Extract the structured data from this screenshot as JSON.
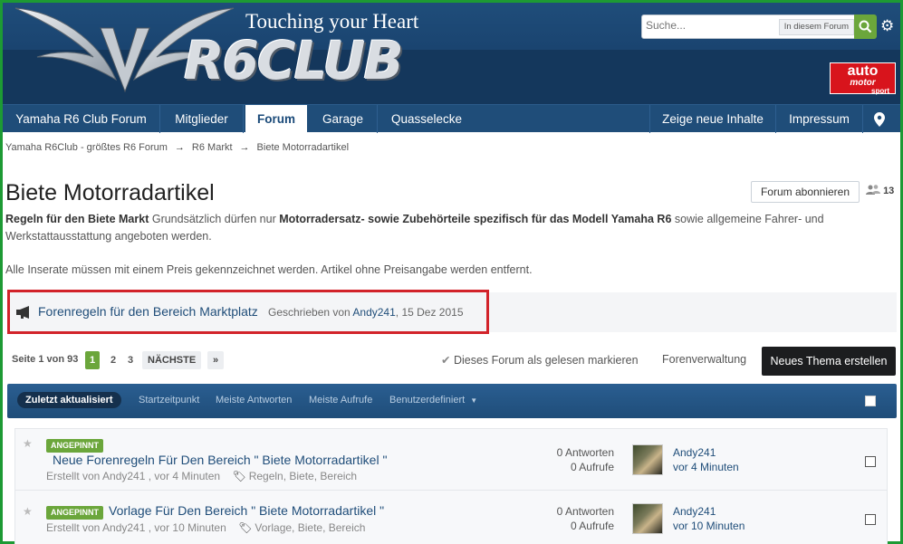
{
  "header": {
    "tagline": "Touching your Heart",
    "logo_text": "R6CLUB",
    "search": {
      "placeholder": "Suche...",
      "scope": "In diesem Forum"
    },
    "ad": {
      "line1": "auto",
      "line2": "motor",
      "line3": "sport"
    }
  },
  "nav": {
    "items": [
      {
        "label": "Yamaha R6 Club Forum"
      },
      {
        "label": "Mitglieder"
      },
      {
        "label": "Forum"
      },
      {
        "label": "Garage"
      },
      {
        "label": "Quasselecke"
      }
    ],
    "right_items": [
      {
        "label": "Zeige neue Inhalte"
      },
      {
        "label": "Impressum"
      }
    ],
    "active_index": 2
  },
  "breadcrumb": {
    "items": [
      "Yamaha R6Club - größtes R6 Forum",
      "R6 Markt",
      "Biete Motorradartikel"
    ],
    "separator": "→"
  },
  "page": {
    "title": "Biete Motorradartikel",
    "subscribe_label": "Forum abonnieren",
    "watchers": "13",
    "desc_bold1": "Regeln für den Biete Markt",
    "desc_text1": " Grundsätzlich dürfen nur ",
    "desc_bold2": "Motorradersatz- sowie Zubehörteile spezifisch für das Modell Yamaha R6",
    "desc_text2": " sowie allgemeine Fahrer- und Werkstattausstattung angeboten werden.",
    "desc_line2": "Alle Inserate müssen mit einem Preis gekennzeichnet werden. Artikel ohne Preisangabe werden entfernt."
  },
  "announcement": {
    "title": "Forenregeln für den Bereich Marktplatz",
    "meta_prefix": "Geschrieben von",
    "author": "Andy241",
    "date": ", 15 Dez 2015"
  },
  "pagination": {
    "label": "Seite 1 von 93",
    "pages": [
      "1",
      "2",
      "3"
    ],
    "next": "NÄCHSTE",
    "last": "»"
  },
  "actions": {
    "mark_read": "Dieses Forum als gelesen markieren",
    "forum_admin": "Forenverwaltung",
    "new_thread": "Neues Thema erstellen"
  },
  "filters": {
    "tabs": [
      "Zuletzt aktualisiert",
      "Startzeitpunkt",
      "Meiste Antworten",
      "Meiste Aufrufe",
      "Benutzerdefiniert"
    ]
  },
  "threads": [
    {
      "badge": "ANGEPINNT",
      "title": "Neue Forenregeln Für Den Bereich \" Biete Motorradartikel \"",
      "meta": "Erstellt von Andy241 , vor 4 Minuten",
      "tags": "Regeln, Biete, Bereich",
      "replies": "0 Antworten",
      "views": "0 Aufrufe",
      "last_author": "Andy241",
      "last_time": "vor 4 Minuten"
    },
    {
      "badge": "ANGEPINNT",
      "title": "Vorlage Für Den Bereich \" Biete Motorradartikel \"",
      "meta": "Erstellt von Andy241 , vor 10 Minuten",
      "tags": "Vorlage, Biete, Bereich",
      "replies": "0 Antworten",
      "views": "0 Aufrufe",
      "last_author": "Andy241",
      "last_time": "vor 10 Minuten"
    }
  ],
  "colors": {
    "brand": "#1f4d79",
    "accent_green": "#6ba63b",
    "highlight_red": "#d2232a",
    "frame_green": "#1d9a34"
  }
}
